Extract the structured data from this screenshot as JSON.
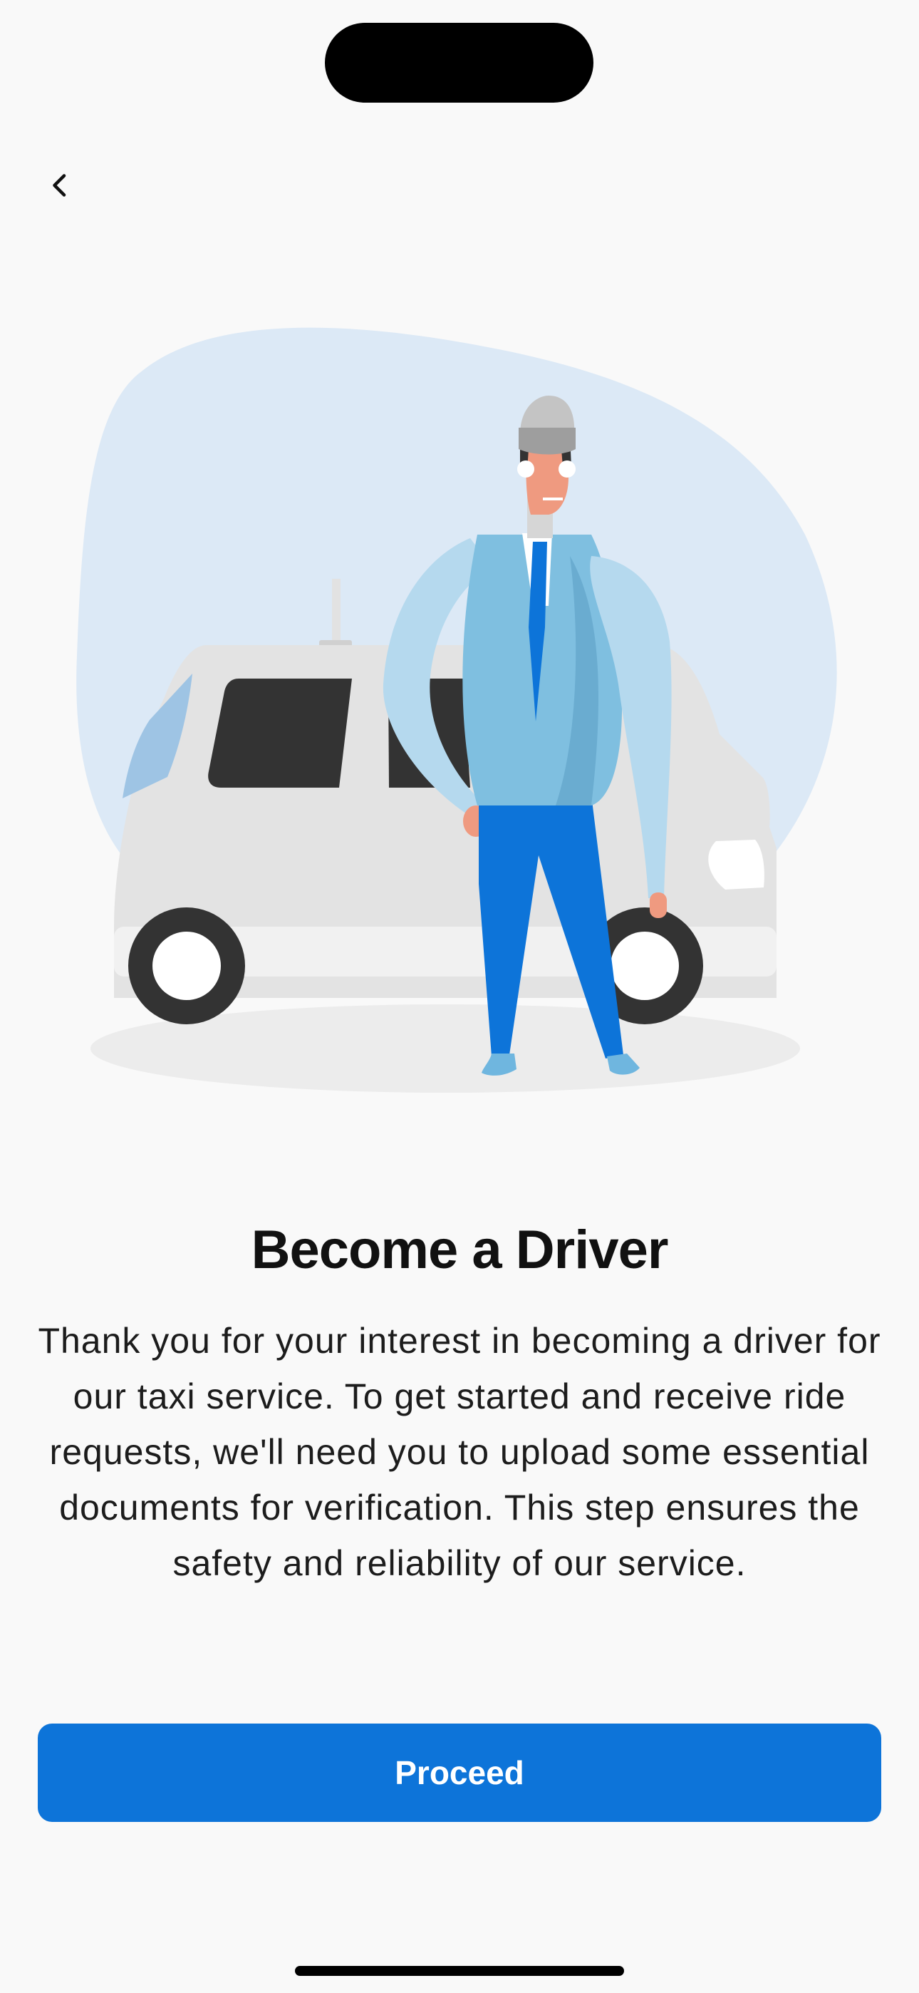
{
  "screen": {
    "title": "Become a Driver",
    "description": "Thank you for your interest in becoming a driver for our taxi service. To get started and receive ride requests, we'll need you to upload some essential documents for verification. This step ensures the safety and reliability of our service.",
    "proceed_label": "Proceed"
  },
  "icons": {
    "back": "chevron-left-icon"
  },
  "colors": {
    "background": "#f9f9f9",
    "primary_button": "#0d74d9",
    "blob": "#dce9f6",
    "car_body": "#e4e4e4",
    "driver_jacket": "#7fbfe0",
    "driver_pants": "#0d74d9"
  }
}
